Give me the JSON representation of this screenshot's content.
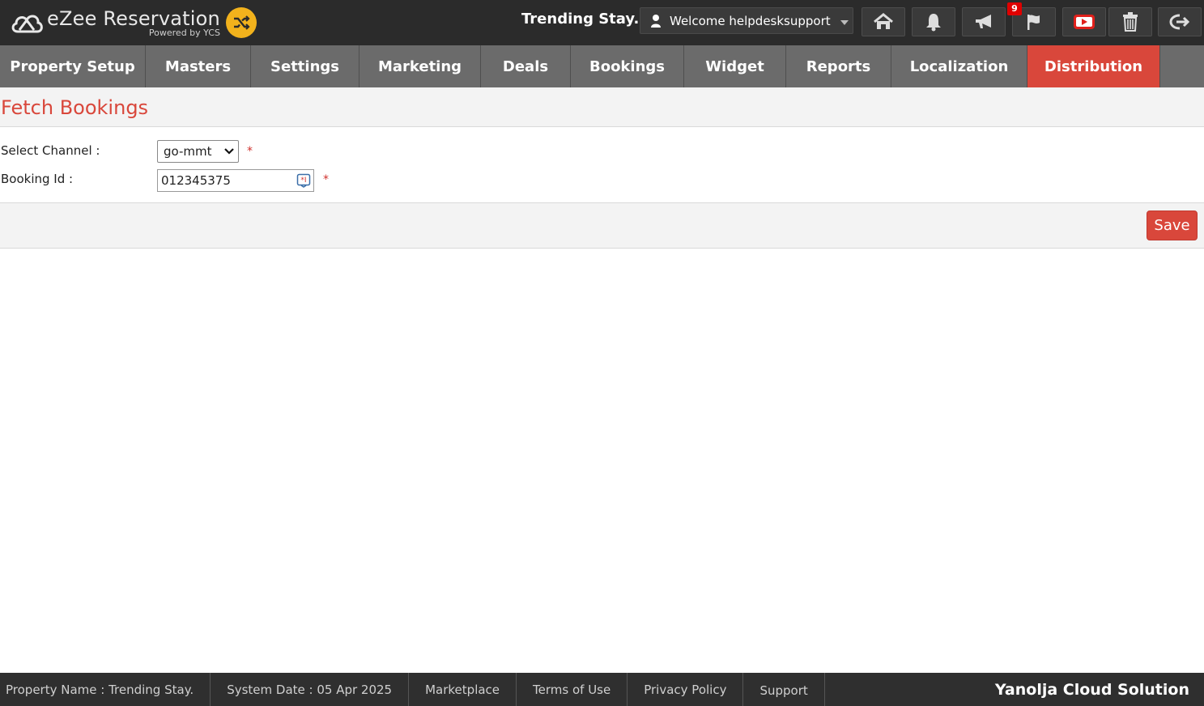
{
  "app": {
    "name": "eZee Reservation",
    "powered_by": "Powered by YCS"
  },
  "header": {
    "hotel_name": "Trending Stay.",
    "welcome": "Welcome helpdesksupport",
    "notification_count": "9"
  },
  "nav": [
    {
      "label": "Property Setup",
      "active": false
    },
    {
      "label": "Masters",
      "active": false
    },
    {
      "label": "Settings",
      "active": false
    },
    {
      "label": "Marketing",
      "active": false
    },
    {
      "label": "Deals",
      "active": false
    },
    {
      "label": "Bookings",
      "active": false
    },
    {
      "label": "Widget",
      "active": false
    },
    {
      "label": "Reports",
      "active": false
    },
    {
      "label": "Localization",
      "active": false
    },
    {
      "label": "Distribution",
      "active": true
    }
  ],
  "page": {
    "title": "Fetch Bookings"
  },
  "form": {
    "channel_label": "Select Channel :",
    "channel_value": "go-mmt",
    "booking_label": "Booking Id :",
    "booking_value": "012345375",
    "required": "*"
  },
  "actions": {
    "save_label": "Save"
  },
  "footer": {
    "property": "Property Name : Trending Stay.",
    "system_date": "System Date : 05 Apr 2025",
    "marketplace": "Marketplace",
    "terms": "Terms of Use",
    "privacy": "Privacy Policy",
    "support": "Support",
    "brand": "Yanolja Cloud Solution"
  },
  "colors": {
    "accent": "#d9473b",
    "topbar": "#2b2b2b",
    "nav": "#6b6b6b",
    "shuffle": "#f2b21c"
  }
}
